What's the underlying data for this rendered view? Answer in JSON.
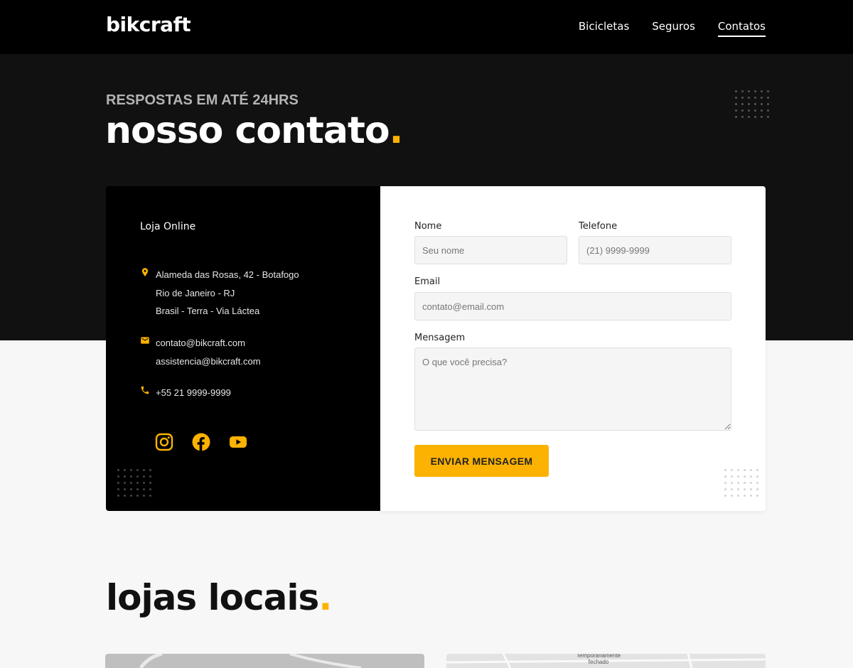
{
  "header": {
    "logo": "bikcraft",
    "nav": [
      {
        "label": "Bicicletas"
      },
      {
        "label": "Seguros"
      },
      {
        "label": "Contatos"
      }
    ]
  },
  "hero": {
    "subtitle": "RESPOSTAS EM ATÉ 24HRS",
    "title": "nosso contato",
    "title_dot": "."
  },
  "contact_info": {
    "store_title": "Loja Online",
    "address": [
      "Alameda das Rosas, 42 - Botafogo",
      "Rio de Janeiro - RJ",
      "Brasil - Terra - Via Láctea"
    ],
    "emails": [
      "contato@bikcraft.com",
      "assistencia@bikcraft.com"
    ],
    "phone": "+55 21 9999-9999",
    "social": [
      "instagram-icon",
      "facebook-icon",
      "youtube-icon"
    ]
  },
  "form": {
    "name_label": "Nome",
    "name_placeholder": "Seu nome",
    "phone_label": "Telefone",
    "phone_placeholder": "(21) 9999-9999",
    "email_label": "Email",
    "email_placeholder": "contato@email.com",
    "message_label": "Mensagem",
    "message_placeholder": "O que você precisa?",
    "submit_label": "ENVIAR MENSAGEM"
  },
  "stores": {
    "title": "lojas locais",
    "title_dot": ".",
    "map2_label": "Temporariamente fechado"
  },
  "colors": {
    "accent": "#fbb200",
    "header_bg": "#000000",
    "hero_bg": "#111111",
    "page_bg": "#f7f7f7"
  }
}
